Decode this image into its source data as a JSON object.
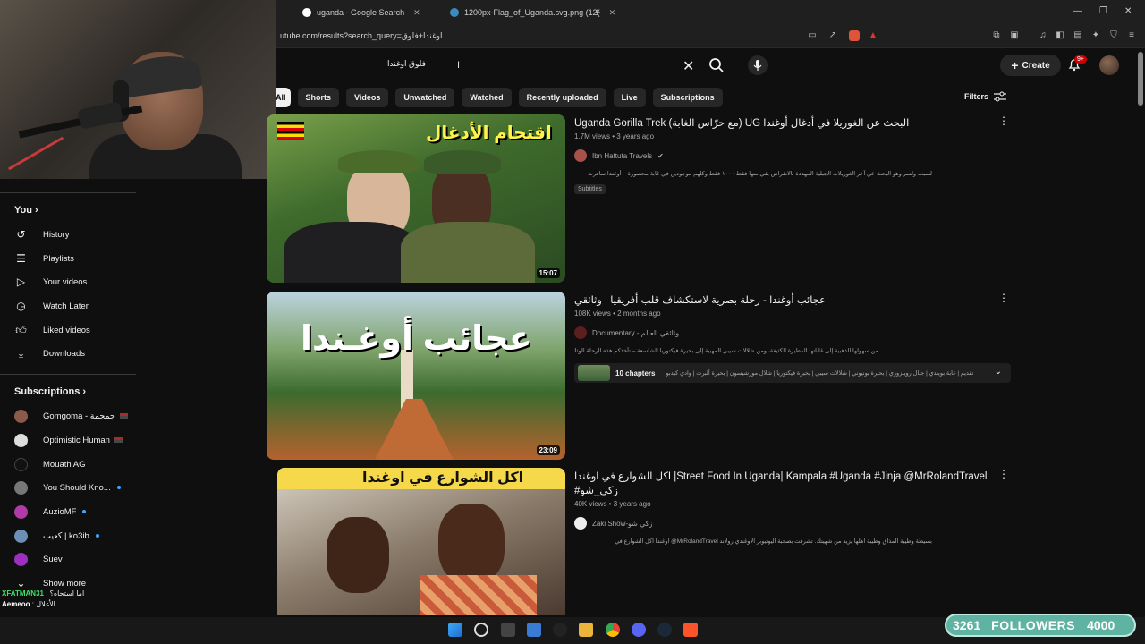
{
  "browser": {
    "tabs": [
      {
        "label": "uganda - Google Search"
      },
      {
        "label": "1200px-Flag_of_Uganda.svg.png (12("
      }
    ],
    "url": "utube.com/results?search_query=اوغندا+فلوق"
  },
  "header": {
    "search_value": "فلوق اوغندا",
    "create_label": "Create",
    "notif_badge": "9+"
  },
  "chips": [
    "All",
    "Shorts",
    "Videos",
    "Unwatched",
    "Watched",
    "Recently uploaded",
    "Live",
    "Subscriptions"
  ],
  "filters_label": "Filters",
  "sidebar": {
    "you_label": "You",
    "items": [
      "History",
      "Playlists",
      "Your videos",
      "Watch Later",
      "Liked videos",
      "Downloads"
    ],
    "subs_label": "Subscriptions",
    "subs": [
      "Gomgoma - جمجمة",
      "Optimistic Human",
      "Mouath AG",
      "You Should Kno...",
      "AuzioMF",
      "كعيب | ko3ib",
      "Suev"
    ],
    "show_more": "Show more"
  },
  "results": [
    {
      "title": "Uganda Gorilla Trek (مع حرّاس الغابة) UG البحث عن الغوريلا في أدغال أوغندا",
      "views": "1.7M views • 3 years ago",
      "channel": "Ibn Hattuta Travels",
      "desc": "لسبب ولسر وهو البحث عن آخر الغوريلات الجبلية المهددة بالانقراض بقي منها فقط ١٠٠٠ فقط وكلهم موجودين في غابة محصورة – أوغندا سافرت",
      "tag": "Subtitles",
      "duration": "15:07",
      "thumb_text": "اقتحام الأدغال"
    },
    {
      "title": "عجائب أوغندا - رحلة بصرية لاستكشاف قلب أفريقيا | وثائقي",
      "views": "108K views • 2 months ago",
      "channel": "Documentary - وثائقي العالم",
      "desc": "من سهولها الذهبية إلى غاباتها المطيرة الكثيفة، ومن شلالات سيبي المهيبة إلى بحيرة فيكتوريا الشاسعة – تأخذكم هذه الرحلة الوثائقية ...",
      "chapters_label": "10 chapters",
      "chapters_desc": "تقديم | غابة بويندي | جبال روينزوري | بحيرة بونيوني | شلالات سيبي | بحيرة فيكتوريا | شلال مورشيسون | بحيرة ألبرت | وادي كيدبو",
      "duration": "23:09",
      "thumb_text": "عجائب أوغـندا"
    },
    {
      "title": "Street Food In Uganda| Kampala #Uganda #Jinja @MrRolandTravel| اكل الشوارع في اوغندا زكي_شو#",
      "views": "40K views • 3 years ago",
      "channel": "Zaki Show-زكي شو",
      "desc": "بسيطة وطيبة المذاق وطيبة اهلها يزيد من شهيتك. تشرفت بصحبة اليوتيوبر الاوغندي رولاند MrRolandTravel@ اوغندا اكل الشوارع في",
      "thumb_text": "اكل الشوارع في اوغندا"
    }
  ],
  "chat": [
    {
      "user": "XFATMAN31",
      "msg": "اما استحاه؟"
    },
    {
      "user": "Aemeoo",
      "msg": "الأغلال"
    }
  ],
  "followers": {
    "count": "3261",
    "label": "FOLLOWERS",
    "goal": "4000"
  },
  "colors": {
    "bg": "#0f0f0f",
    "accent": "#3ea6ff",
    "chip_active": "#f1f1f1",
    "followers_bg": "#5fb3a3"
  }
}
